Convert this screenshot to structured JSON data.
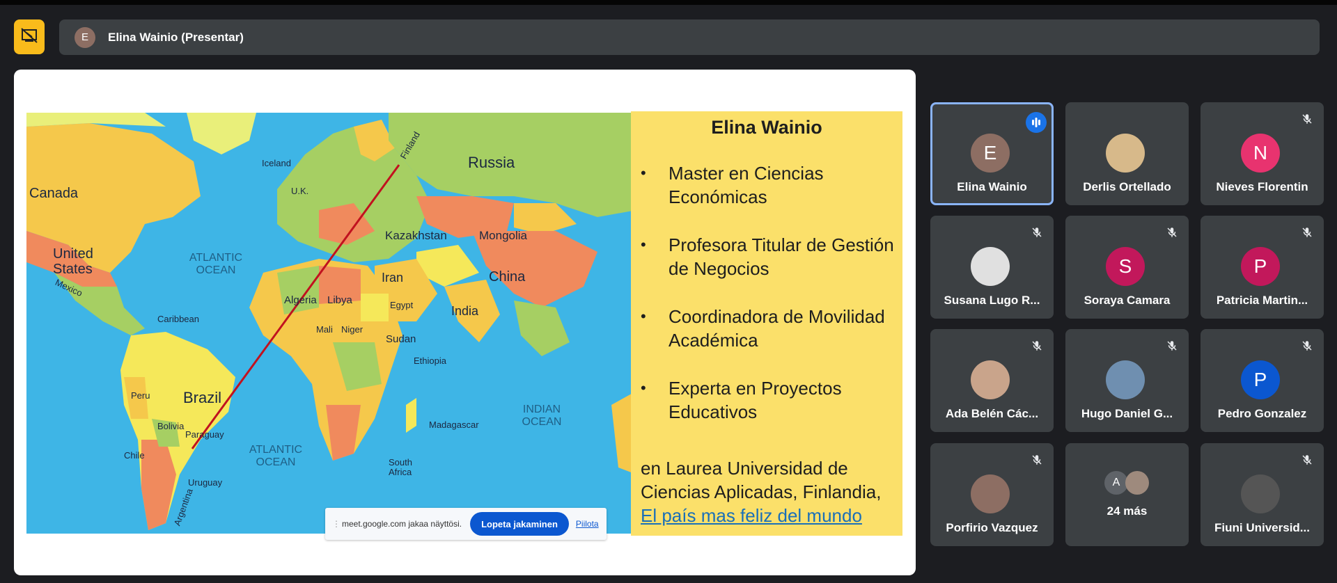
{
  "presenter_bar": {
    "avatar_initial": "E",
    "presenter_name": "Elina Wainio (Presentar)"
  },
  "slide": {
    "map_labels": {
      "russia": "Russia",
      "canada": "Canada",
      "united_states": "United States",
      "kazakhstan": "Kazakhstan",
      "mongolia": "Mongolia",
      "china": "China",
      "iran": "Iran",
      "india": "India",
      "algeria": "Algeria",
      "libya": "Libya",
      "brazil": "Brazil",
      "argentina": "Argentina",
      "atlantic_north": "ATLANTIC OCEAN",
      "atlantic_south": "ATLANTIC OCEAN",
      "indian_ocean": "INDIAN OCEAN",
      "iceland": "Iceland",
      "uk": "U.K.",
      "finland": "Finland",
      "mexico": "Mexico",
      "madagascar": "Madagascar",
      "chile": "Chile",
      "peru": "Peru",
      "bolivia": "Bolivia",
      "paraguay": "Paraguay",
      "uruguay": "Uruguay",
      "sudan": "Sudan",
      "egypt": "Egypt",
      "mali": "Mali",
      "niger": "Niger",
      "ethiopia": "Ethiopia",
      "south_africa": "South Africa",
      "caribbean": "Caribbean"
    },
    "panel": {
      "title": "Elina Wainio",
      "bullets": [
        "Master en Ciencias Económicas",
        "Profesora Titular de Gestión de Negocios",
        "Coordinadora de Movilidad Académica",
        "Experta en Proyectos Educativos"
      ],
      "footer_text": "en Laurea Universidad de Ciencias Aplicadas, Finlandia,",
      "footer_link": "El país mas feliz del mundo"
    }
  },
  "share_notice": {
    "text": "meet.google.com jakaa näyttösi.",
    "stop_button": "Lopeta jakaminen",
    "hide_link": "Piilota"
  },
  "participants": [
    {
      "name": "Elina Wainio",
      "initial": "E",
      "color": "#8d6e63",
      "state": "speaking"
    },
    {
      "name": "Derlis Ortellado",
      "initial": "",
      "color": "#d7b98a",
      "state": "none"
    },
    {
      "name": "Nieves Florentin",
      "initial": "N",
      "color": "#e8336f",
      "state": "muted"
    },
    {
      "name": "Susana Lugo R...",
      "initial": "",
      "color": "#e0e0e0",
      "state": "muted"
    },
    {
      "name": "Soraya Camara",
      "initial": "S",
      "color": "#c2185b",
      "state": "muted"
    },
    {
      "name": "Patricia Martin...",
      "initial": "P",
      "color": "#c2185b",
      "state": "muted"
    },
    {
      "name": "Ada Belén Các...",
      "initial": "",
      "color": "#c9a48b",
      "state": "muted"
    },
    {
      "name": "Hugo Daniel G...",
      "initial": "",
      "color": "#6f8fb0",
      "state": "muted"
    },
    {
      "name": "Pedro Gonzalez",
      "initial": "P",
      "color": "#0b57d0",
      "state": "muted"
    },
    {
      "name": "Porfirio Vazquez",
      "initial": "",
      "color": "#8d6e63",
      "state": "muted"
    },
    {
      "name": "24 más",
      "initials": [
        "A",
        ""
      ],
      "state": "none"
    },
    {
      "name": "Fiuni Universid...",
      "initial": "",
      "state": "muted"
    }
  ]
}
